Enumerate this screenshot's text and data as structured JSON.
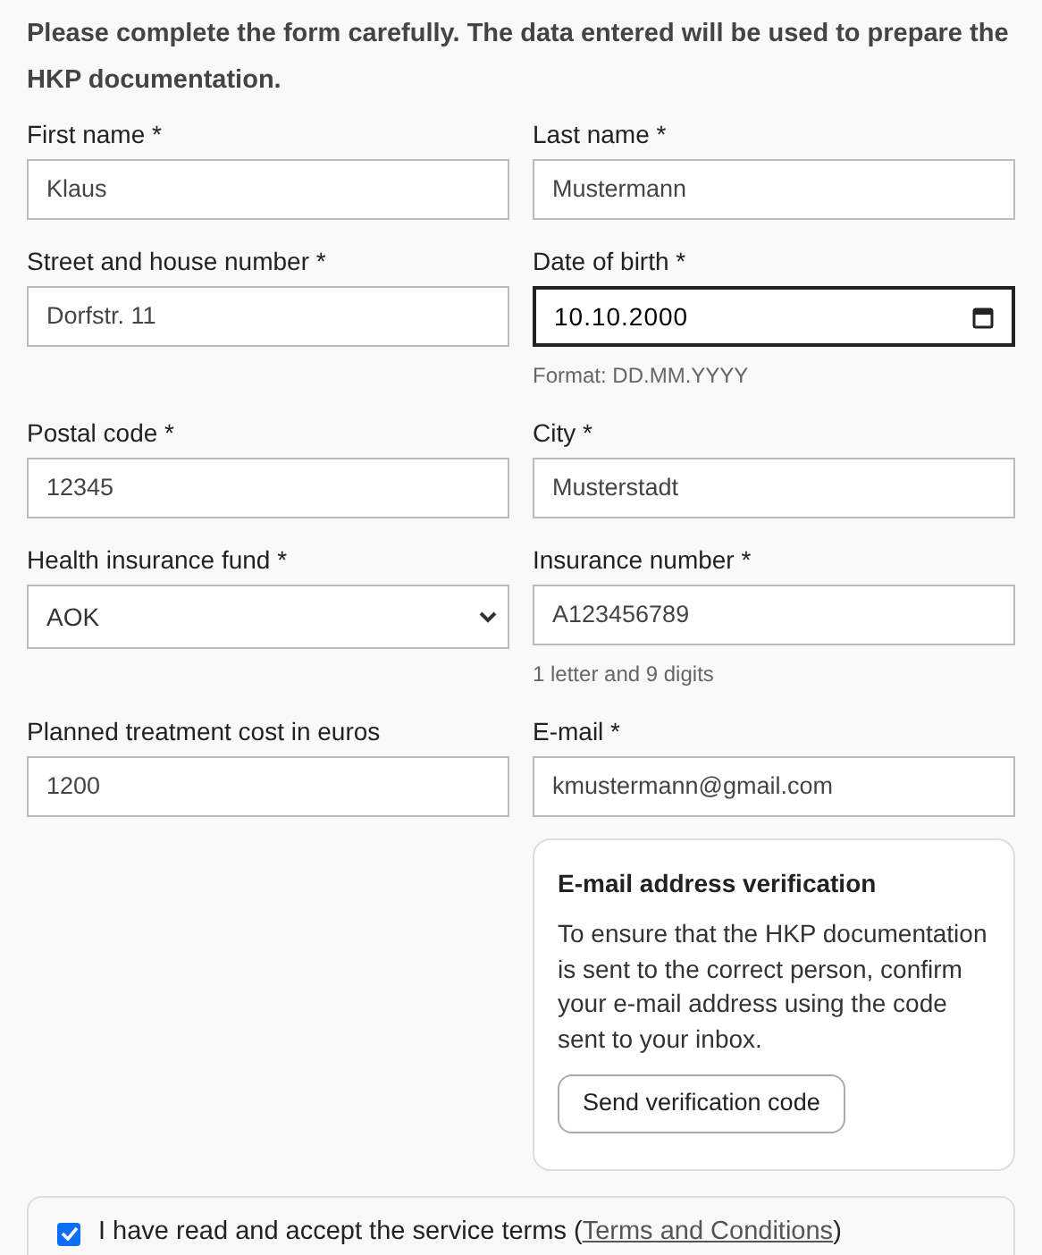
{
  "intro": "Please complete the form carefully. The data entered will be used to prepare the HKP documentation.",
  "fields": [
    {
      "label": "First name *",
      "kind": "text",
      "value": "Klaus",
      "focused": false
    },
    {
      "label": "Last name *",
      "kind": "text",
      "value": "Mustermann",
      "focused": false
    },
    {
      "label": "Street and house number *",
      "kind": "text",
      "value": "Dorfstr. 11",
      "focused": false
    },
    {
      "label": "Date of birth *",
      "kind": "date",
      "value": "10.10.2000",
      "focused": true,
      "hint": "Format: DD.MM.YYYY"
    },
    {
      "label": "Postal code *",
      "kind": "text",
      "value": "12345",
      "focused": false
    },
    {
      "label": "City *",
      "kind": "text",
      "value": "Musterstadt",
      "focused": false
    },
    {
      "label": "Health insurance fund *",
      "kind": "select",
      "value": "AOK",
      "focused": false
    },
    {
      "label": "Insurance number *",
      "kind": "text",
      "value": "A123456789",
      "focused": false,
      "hint": "1 letter and 9 digits"
    },
    {
      "label": "Planned treatment cost in euros",
      "kind": "text",
      "value": "1200",
      "focused": false
    },
    {
      "label": "E-mail *",
      "kind": "text",
      "value": "kmustermann@gmail.com",
      "focused": false
    }
  ],
  "verification": {
    "title": "E-mail address verification",
    "text": "To ensure that the HKP documentation is sent to the correct person, confirm your e-mail address using the code sent to your inbox.",
    "button": "Send verification code"
  },
  "terms": {
    "checked": true,
    "text_before": "I have read and accept the service terms (",
    "link": "Terms and Conditions",
    "text_after": ")"
  }
}
